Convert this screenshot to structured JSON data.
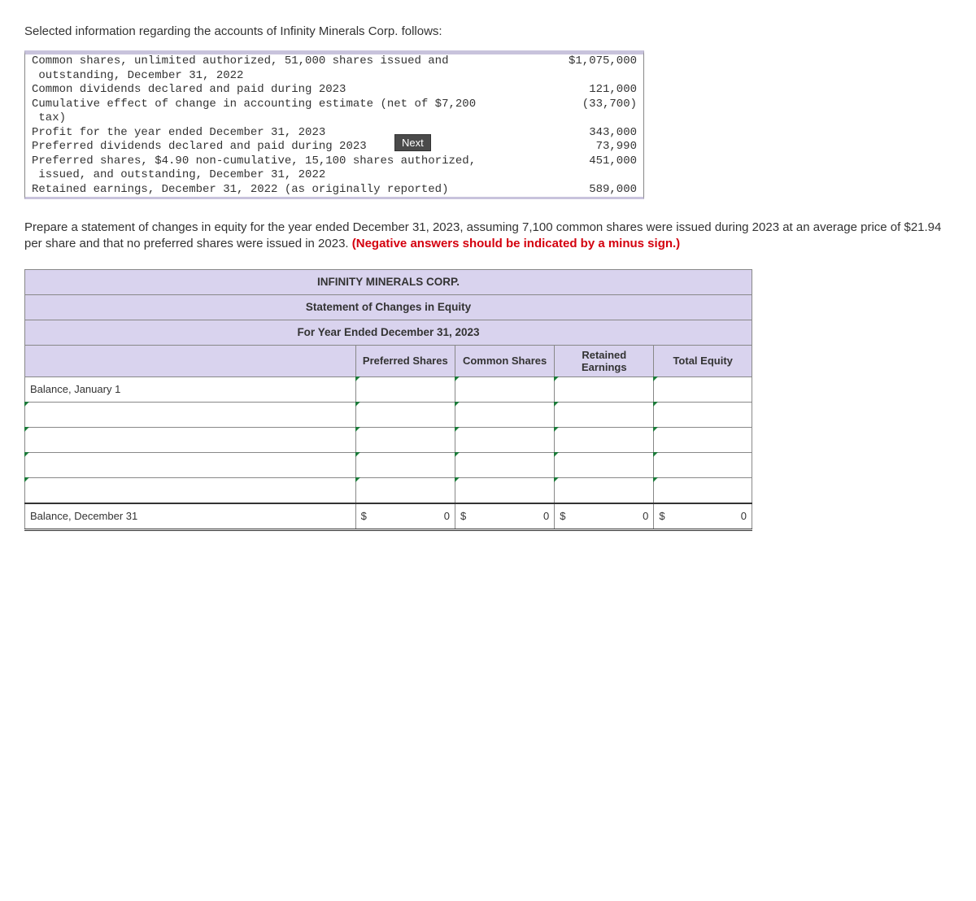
{
  "intro": "Selected information regarding the accounts of Infinity Minerals Corp. follows:",
  "accounts": [
    {
      "label": "Common shares, unlimited authorized, 51,000 shares issued and\n outstanding, December 31, 2022",
      "value": "$1,075,000"
    },
    {
      "label": "Common dividends declared and paid during 2023",
      "value": "121,000"
    },
    {
      "label": "Cumulative effect of change in accounting estimate (net of $7,200\n tax)",
      "value": "(33,700)"
    },
    {
      "label": "Profit for the year ended December 31, 2023",
      "value": "343,000"
    },
    {
      "label": "Preferred dividends declared and paid during 2023",
      "value": "73,990"
    },
    {
      "label": "Preferred shares, $4.90 non-cumulative, 15,100 shares authorized,\n issued, and outstanding, December 31, 2022",
      "value": "451,000"
    },
    {
      "label": "Retained earnings, December 31, 2022 (as originally reported)",
      "value": "589,000"
    }
  ],
  "next_button": "Next",
  "instructions_main": "Prepare a statement of changes in equity for the year ended December 31, 2023, assuming 7,100 common shares were issued during 2023 at an average price of $21.94 per share and that no preferred shares were issued in 2023. ",
  "instructions_red": "(Negative answers should be indicated by a minus sign.)",
  "table": {
    "title1": "INFINITY MINERALS CORP.",
    "title2": "Statement of Changes in Equity",
    "title3": "For Year Ended December 31, 2023",
    "cols": [
      "Preferred Shares",
      "Common Shares",
      "Retained Earnings",
      "Total Equity"
    ],
    "row_labels": {
      "first": "Balance, January 1",
      "last": "Balance, December 31"
    },
    "totals": {
      "preferred": {
        "sym": "$",
        "val": "0"
      },
      "common": {
        "sym": "$",
        "val": "0"
      },
      "retained": {
        "sym": "$",
        "val": "0"
      },
      "total": {
        "sym": "$",
        "val": "0"
      }
    }
  }
}
